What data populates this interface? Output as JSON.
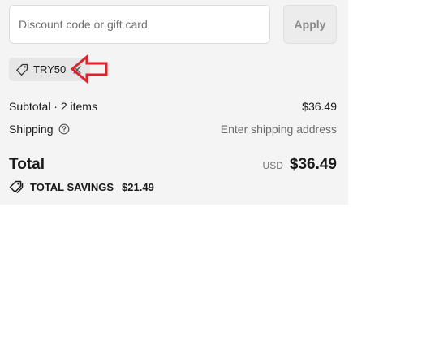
{
  "discount": {
    "placeholder": "Discount code or gift card",
    "apply_label": "Apply"
  },
  "applied_code": {
    "code": "TRY50",
    "tag_icon": "tag-icon",
    "remove_icon": "close-icon"
  },
  "summary": {
    "subtotal_label": "Subtotal · 2 items",
    "subtotal_value": "$36.49",
    "shipping_label": "Shipping",
    "shipping_help_icon": "question-circle-icon",
    "shipping_value": "Enter shipping address",
    "total_label": "Total",
    "currency": "USD",
    "total_value": "$36.49",
    "savings_icon": "tags-icon",
    "savings_label": "TOTAL SAVINGS",
    "savings_value": "$21.49"
  },
  "colors": {
    "panel_bg": "#f4f4f4",
    "annotation_arrow": "#e0202a"
  }
}
